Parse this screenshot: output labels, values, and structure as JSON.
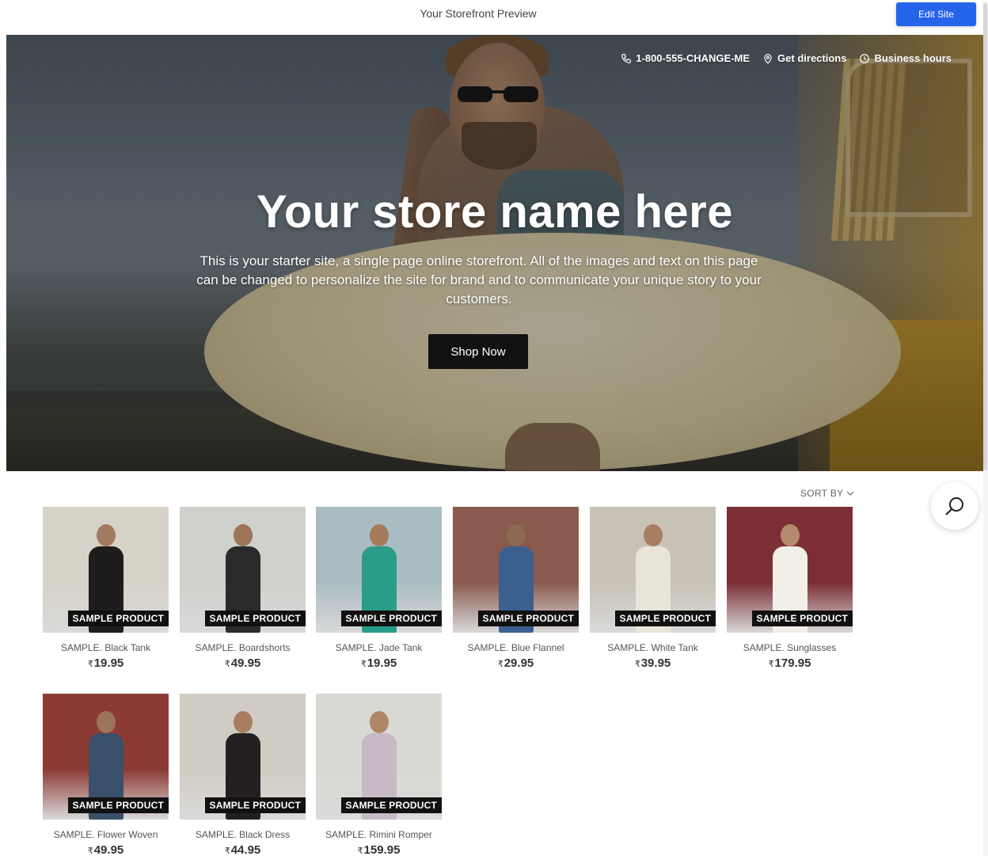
{
  "preview_bar": {
    "title": "Your Storefront Preview",
    "edit_label": "Edit Site",
    "accent": "#2563eb"
  },
  "hero": {
    "nav": [
      {
        "label": "1-800-555-CHANGE-ME",
        "icon": "phone-icon"
      },
      {
        "label": "Get directions",
        "icon": "location-pin-icon"
      },
      {
        "label": "Business hours",
        "icon": "clock-icon"
      }
    ],
    "title": "Your store name here",
    "description": "This is your starter site, a single page online storefront. All of the images and text on this page can be changed to personalize the site for brand and to communicate your unique story to your customers.",
    "cta": "Shop Now"
  },
  "catalog": {
    "sort_label": "SORT BY",
    "search_icon": "search-icon",
    "badge_label": "SAMPLE PRODUCT",
    "currency_symbol": "₹",
    "products": [
      {
        "name": "SAMPLE. Black Tank",
        "price": "19.95",
        "bg": "#d7d2c8",
        "body": "#1e1c1c",
        "skin": "#a27b60"
      },
      {
        "name": "SAMPLE. Boardshorts",
        "price": "49.95",
        "bg": "#cfd1cc",
        "body": "#2a2a2a",
        "skin": "#9c7456"
      },
      {
        "name": "SAMPLE. Jade Tank",
        "price": "19.95",
        "bg": "#a9bcc2",
        "body": "#2a9c8a",
        "skin": "#a57b5d"
      },
      {
        "name": "SAMPLE. Blue Flannel",
        "price": "29.95",
        "bg": "#8a5a4e",
        "body": "#3b5f8f",
        "skin": "#8d6a52"
      },
      {
        "name": "SAMPLE. White Tank",
        "price": "39.95",
        "bg": "#c8c2b6",
        "body": "#e9e4da",
        "skin": "#a87e62"
      },
      {
        "name": "SAMPLE. Sunglasses",
        "price": "179.95",
        "bg": "#7b2e34",
        "body": "#f2efe8",
        "skin": "#b58a6c"
      },
      {
        "name": "SAMPLE. Flower Woven",
        "price": "49.95",
        "bg": "#8c3a34",
        "body": "#3a4f6a",
        "skin": "#9c7458"
      },
      {
        "name": "SAMPLE. Black Dress",
        "price": "44.95",
        "bg": "#d1ccc3",
        "body": "#231f22",
        "skin": "#a97d5f"
      },
      {
        "name": "SAMPLE. Rimini Romper",
        "price": "159.95",
        "bg": "#d9d9d4",
        "body": "#c7b9c6",
        "skin": "#b08666"
      }
    ]
  }
}
